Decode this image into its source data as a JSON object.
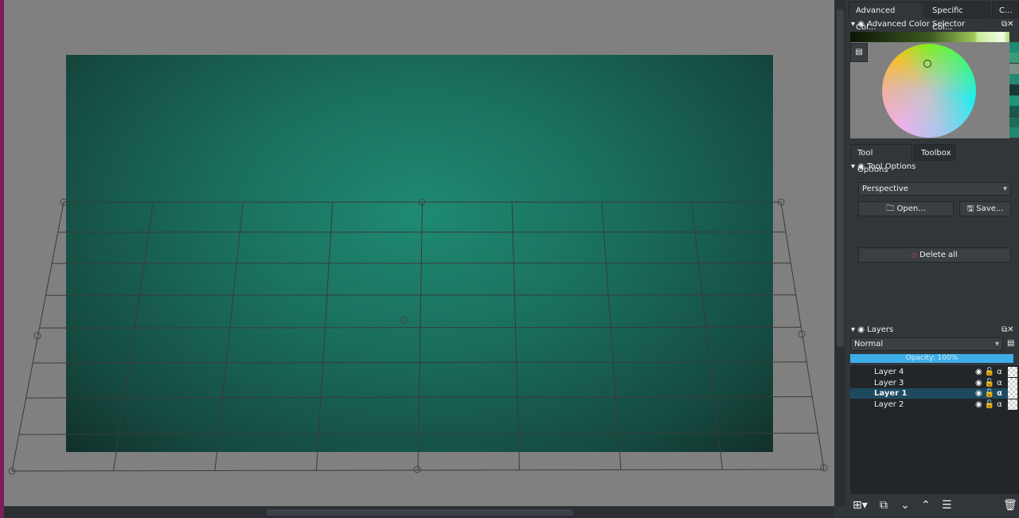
{
  "dockers": {
    "top_tabs": [
      "Advanced Col...",
      "Specific Col...",
      "C..."
    ],
    "color_selector": {
      "title": "Advanced Color Selector",
      "selected_color": "#a6d86a",
      "recent_colors": [
        "#1e8a72",
        "#3b9a7a",
        "#7f8f86",
        "#1f8a72",
        "#143b33",
        "#1e9478",
        "#175a4b",
        "#1a6c58",
        "#1e8a72"
      ]
    },
    "mid_tabs": [
      "Tool Options",
      "Toolbox"
    ],
    "tool_options": {
      "title": "Tool Options",
      "mode": "Perspective",
      "open_label": "Open...",
      "save_label": "Save...",
      "delete_label": "Delete all"
    },
    "layers": {
      "title": "Layers",
      "blend_mode": "Normal",
      "opacity_label": "Opacity:  100%",
      "opacity": 100,
      "items": [
        {
          "name": "Layer 4",
          "selected": false
        },
        {
          "name": "Layer 3",
          "selected": false
        },
        {
          "name": "Layer 1",
          "selected": true
        },
        {
          "name": "Layer 2",
          "selected": false
        }
      ]
    }
  },
  "colors": {
    "accent": "#3daee9",
    "selection": "#1e4a60",
    "canvas_bg": "#808080"
  }
}
